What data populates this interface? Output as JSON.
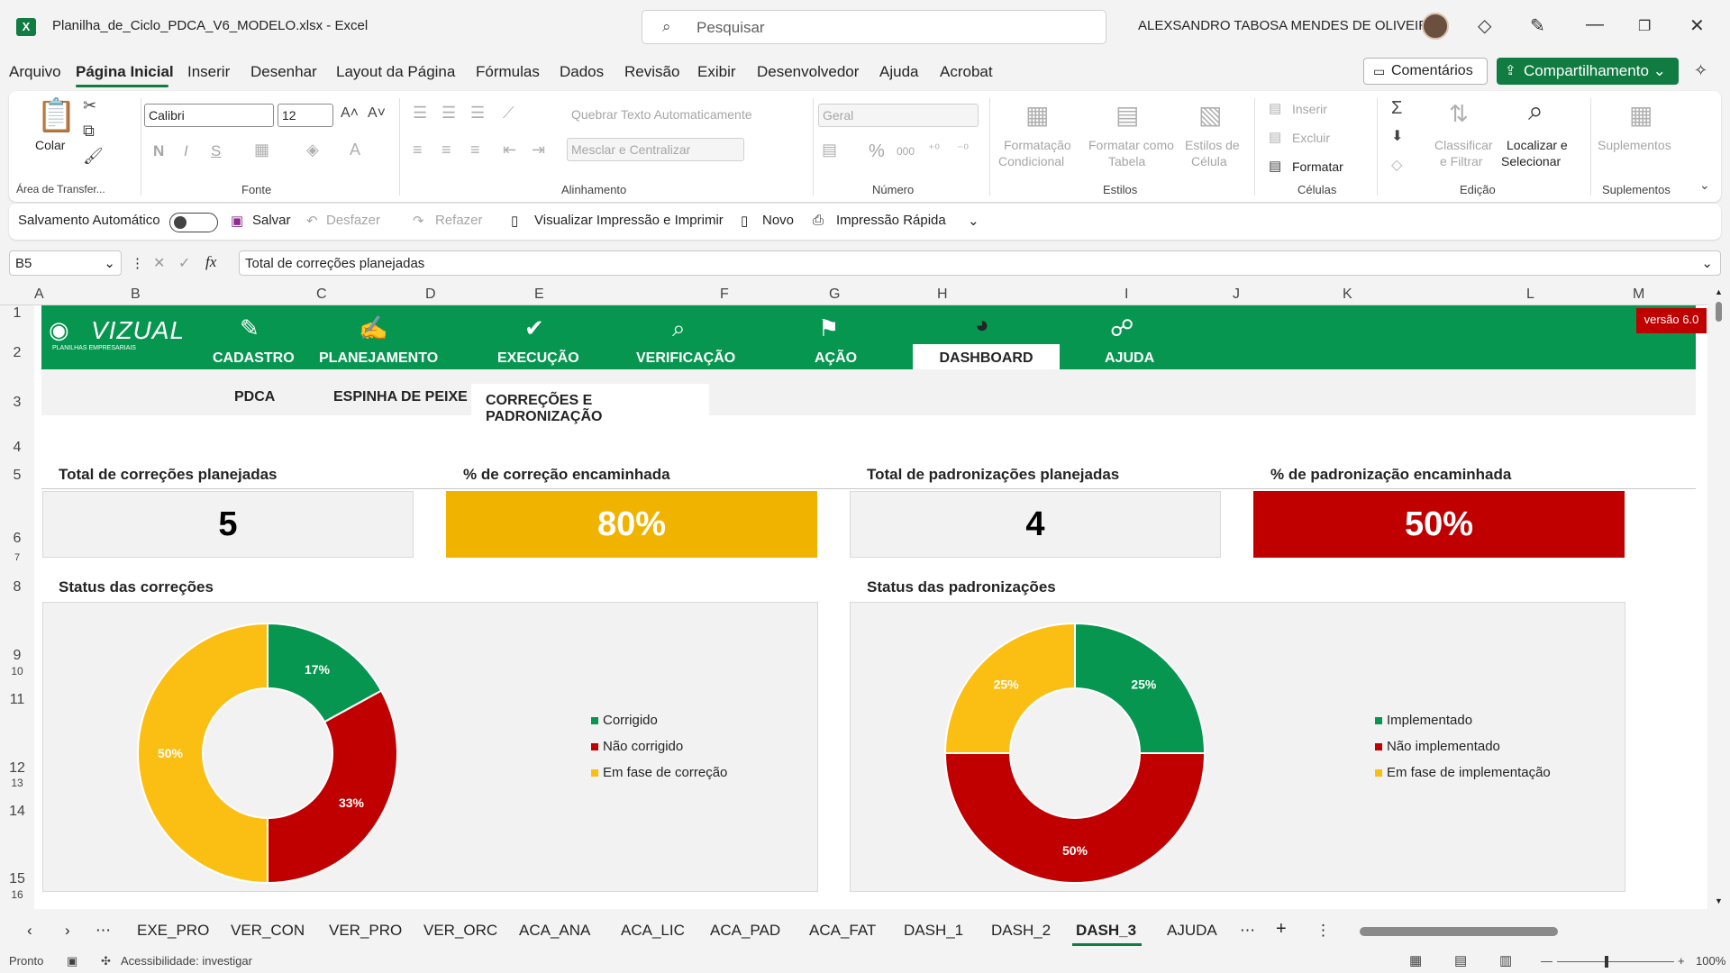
{
  "window": {
    "app_icon": "X",
    "title": "Planilha_de_Ciclo_PDCA_V6_MODELO.xlsx  -  Excel",
    "search_placeholder": "Pesquisar",
    "user": "ALEXSANDRO TABOSA MENDES DE OLIVEIRA"
  },
  "menu": [
    "Arquivo",
    "Página Inicial",
    "Inserir",
    "Desenhar",
    "Layout da Página",
    "Fórmulas",
    "Dados",
    "Revisão",
    "Exibir",
    "Desenvolvedor",
    "Ajuda",
    "Acrobat"
  ],
  "menu_buttons": {
    "comments": "Comentários",
    "share": "Compartilhamento"
  },
  "ribbon": {
    "clipboard": {
      "paste": "Colar",
      "label": "Área de Transfer..."
    },
    "font": {
      "name": "Calibri",
      "size": "12",
      "label": "Fonte",
      "bold": "N",
      "italic": "I",
      "underline": "S"
    },
    "alignment": {
      "wrap": "Quebrar Texto Automaticamente",
      "merge": "Mesclar e Centralizar",
      "label": "Alinhamento"
    },
    "number": {
      "format": "Geral",
      "label": "Número",
      "percent": "%",
      "thousands": "000"
    },
    "styles": {
      "conditional_1": "Formatação",
      "conditional_2": "Condicional",
      "table_1": "Formatar como",
      "table_2": "Tabela",
      "cell_1": "Estilos de",
      "cell_2": "Célula",
      "label": "Estilos"
    },
    "cells": {
      "insert": "Inserir",
      "delete": "Excluir",
      "format": "Formatar",
      "label": "Células"
    },
    "editing": {
      "sort_1": "Classificar",
      "sort_2": "e Filtrar",
      "find_1": "Localizar e",
      "find_2": "Selecionar",
      "label": "Edição"
    },
    "addins": {
      "btn": "Suplementos",
      "label": "Suplementos"
    }
  },
  "qat": {
    "autosave": "Salvamento Automático",
    "save": "Salvar",
    "undo": "Desfazer",
    "redo": "Refazer",
    "print": "Visualizar Impressão e Imprimir",
    "new": "Novo",
    "quickprint": "Impressão Rápida"
  },
  "formula_bar": {
    "cell": "B5",
    "fx": "fx",
    "content": "Total de correções planejadas"
  },
  "columns": [
    "A",
    "B",
    "C",
    "D",
    "E",
    "F",
    "G",
    "H",
    "I",
    "J",
    "K",
    "L",
    "M"
  ],
  "rows": [
    "1",
    "2",
    "3",
    "4",
    "5",
    "6",
    "7",
    "8",
    "9",
    "10",
    "11",
    "12",
    "13",
    "14",
    "15",
    "16"
  ],
  "dashboard": {
    "logo": "VIZUAL",
    "logo_sub": "PLANILHAS EMPRESARIAIS",
    "version": "versão 6.0",
    "nav": [
      "CADASTRO",
      "PLANEJAMENTO",
      "EXECUÇÃO",
      "VERIFICAÇÃO",
      "AÇÃO",
      "DASHBOARD",
      "AJUDA"
    ],
    "subtabs": [
      "PDCA",
      "ESPINHA DE PEIXE",
      "CORREÇÕES E PADRONIZAÇÃO"
    ],
    "kpis": [
      {
        "label": "Total de correções planejadas",
        "value": "5",
        "bg": "#f2f2f2",
        "color": "#000000"
      },
      {
        "label": "% de correção encaminhada",
        "value": "80%",
        "bg": "#f0b400",
        "color": "#ffffff"
      },
      {
        "label": "Total de padronizações planejadas",
        "value": "4",
        "bg": "#f2f2f2",
        "color": "#000000"
      },
      {
        "label": "% de padronização encaminhada",
        "value": "50%",
        "bg": "#c00000",
        "color": "#ffffff"
      }
    ],
    "charts_titles": [
      "Status das correções",
      "Status das padronizações"
    ]
  },
  "chart_data": [
    {
      "type": "pie",
      "title": "Status das correções",
      "categories": [
        "Corrigido",
        "Não corrigido",
        "Em fase de correção"
      ],
      "values": [
        17,
        33,
        50
      ],
      "labels": [
        "17%",
        "33%",
        "50%"
      ],
      "colors": [
        "#079650",
        "#c00000",
        "#fbbf14"
      ]
    },
    {
      "type": "pie",
      "title": "Status das padronizações",
      "categories": [
        "Implementado",
        "Não implementado",
        "Em fase de implementação"
      ],
      "values": [
        25,
        50,
        25
      ],
      "labels": [
        "25%",
        "50%",
        "25%"
      ],
      "colors": [
        "#079650",
        "#c00000",
        "#fbbf14"
      ]
    }
  ],
  "sheet_tabs": [
    "EXE_PRO",
    "VER_CON",
    "VER_PRO",
    "VER_ORC",
    "ACA_ANA",
    "ACA_LIC",
    "ACA_PAD",
    "ACA_FAT",
    "DASH_1",
    "DASH_2",
    "DASH_3",
    "AJUDA"
  ],
  "status": {
    "ready": "Pronto",
    "accessibility": "Acessibilidade: investigar",
    "zoom": "100%"
  }
}
